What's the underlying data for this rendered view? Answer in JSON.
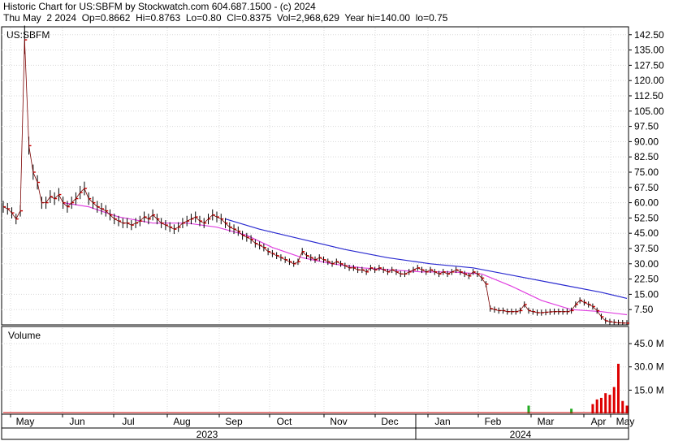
{
  "header": {
    "line1": "Historic Chart for US:SBFM by Stockwatch.com 604.687.1500 - (c) 2024",
    "line2": "Thu May  2 2024  Op=0.8662  Hi=0.8763  Lo=0.80  Cl=0.8375  Vol=2,968,629  Year hi=140.00  lo=0.75"
  },
  "chart_data": {
    "type": "bar",
    "symbol": "US:SBFM",
    "price_axis": {
      "range": [
        0,
        146
      ],
      "ticks": [
        142.5,
        135,
        127.5,
        120,
        112.5,
        105,
        97.5,
        90,
        82.5,
        75,
        67.5,
        60,
        52.5,
        45,
        37.5,
        30,
        22.5,
        15,
        7.5
      ],
      "tick_labels": [
        "142.50",
        "135.00",
        "127.50",
        "120.00",
        "112.50",
        "105.00",
        "97.50",
        "90.00",
        "82.50",
        "75.00",
        "67.50",
        "60.00",
        "52.50",
        "45.00",
        "37.50",
        "30.00",
        "22.50",
        "15.00",
        "7.50"
      ]
    },
    "volume_panel": {
      "label": "Volume",
      "range": [
        0,
        55
      ],
      "ticks": [
        45,
        30,
        15
      ],
      "tick_labels": [
        "45.0 M",
        "30.0 M",
        "15.0 M"
      ]
    },
    "x_axis": {
      "months": [
        "May",
        "Jun",
        "Jul",
        "Aug",
        "Sep",
        "Oct",
        "Nov",
        "Dec",
        "Jan",
        "Feb",
        "Mar",
        "Apr",
        "May"
      ],
      "years": [
        "2023",
        "2024"
      ]
    },
    "price_points": [
      [
        0,
        58
      ],
      [
        1,
        57
      ],
      [
        2,
        55
      ],
      [
        3,
        52
      ],
      [
        4,
        56
      ],
      [
        5,
        140
      ],
      [
        6,
        88
      ],
      [
        7,
        75
      ],
      [
        8,
        70
      ],
      [
        9,
        60
      ],
      [
        10,
        60
      ],
      [
        11,
        63
      ],
      [
        12,
        62
      ],
      [
        13,
        64
      ],
      [
        14,
        60
      ],
      [
        15,
        58
      ],
      [
        16,
        60
      ],
      [
        17,
        62
      ],
      [
        18,
        65
      ],
      [
        19,
        67
      ],
      [
        20,
        62
      ],
      [
        21,
        60
      ],
      [
        22,
        58
      ],
      [
        23,
        57
      ],
      [
        24,
        56
      ],
      [
        25,
        54
      ],
      [
        26,
        52
      ],
      [
        27,
        51
      ],
      [
        28,
        50
      ],
      [
        29,
        50
      ],
      [
        30,
        49
      ],
      [
        31,
        50
      ],
      [
        32,
        51
      ],
      [
        33,
        53
      ],
      [
        34,
        52
      ],
      [
        35,
        54
      ],
      [
        36,
        52
      ],
      [
        37,
        50
      ],
      [
        38,
        49
      ],
      [
        39,
        48
      ],
      [
        40,
        47
      ],
      [
        41,
        48
      ],
      [
        42,
        50
      ],
      [
        43,
        51
      ],
      [
        44,
        52
      ],
      [
        45,
        53
      ],
      [
        46,
        51
      ],
      [
        47,
        50
      ],
      [
        48,
        52
      ],
      [
        49,
        54
      ],
      [
        50,
        53
      ],
      [
        51,
        52
      ],
      [
        52,
        50
      ],
      [
        53,
        48
      ],
      [
        54,
        47
      ],
      [
        55,
        46
      ],
      [
        56,
        44
      ],
      [
        57,
        43
      ],
      [
        58,
        42
      ],
      [
        59,
        40
      ],
      [
        60,
        39
      ],
      [
        61,
        38
      ],
      [
        62,
        36
      ],
      [
        63,
        35
      ],
      [
        64,
        34
      ],
      [
        65,
        33
      ],
      [
        66,
        32
      ],
      [
        67,
        31
      ],
      [
        68,
        30
      ],
      [
        69,
        31
      ],
      [
        70,
        36
      ],
      [
        71,
        34
      ],
      [
        72,
        33
      ],
      [
        73,
        32
      ],
      [
        74,
        33
      ],
      [
        75,
        32
      ],
      [
        76,
        31
      ],
      [
        77,
        30
      ],
      [
        78,
        31
      ],
      [
        79,
        30
      ],
      [
        80,
        29
      ],
      [
        81,
        28
      ],
      [
        82,
        28
      ],
      [
        83,
        27
      ],
      [
        84,
        27
      ],
      [
        85,
        26
      ],
      [
        86,
        28
      ],
      [
        87,
        27
      ],
      [
        88,
        28
      ],
      [
        89,
        27
      ],
      [
        90,
        26
      ],
      [
        91,
        27
      ],
      [
        92,
        26
      ],
      [
        93,
        25
      ],
      [
        94,
        25
      ],
      [
        95,
        26
      ],
      [
        96,
        27
      ],
      [
        97,
        28
      ],
      [
        98,
        27
      ],
      [
        99,
        26
      ],
      [
        100,
        27
      ],
      [
        101,
        26
      ],
      [
        102,
        25
      ],
      [
        103,
        26
      ],
      [
        104,
        25
      ],
      [
        105,
        26
      ],
      [
        106,
        27
      ],
      [
        107,
        26
      ],
      [
        108,
        25
      ],
      [
        109,
        24
      ],
      [
        110,
        26
      ],
      [
        111,
        25
      ],
      [
        112,
        23
      ],
      [
        113,
        20
      ],
      [
        114,
        8
      ],
      [
        115,
        7.5
      ],
      [
        116,
        7
      ],
      [
        117,
        7
      ],
      [
        118,
        6.5
      ],
      [
        119,
        6.5
      ],
      [
        120,
        6.5
      ],
      [
        121,
        7
      ],
      [
        122,
        10
      ],
      [
        123,
        7
      ],
      [
        124,
        6.5
      ],
      [
        125,
        6
      ],
      [
        126,
        6
      ],
      [
        127,
        6.2
      ],
      [
        128,
        6.4
      ],
      [
        129,
        6.5
      ],
      [
        130,
        6.5
      ],
      [
        131,
        6.5
      ],
      [
        132,
        6.5
      ],
      [
        133,
        7
      ],
      [
        134,
        10
      ],
      [
        135,
        12
      ],
      [
        136,
        11
      ],
      [
        137,
        10
      ],
      [
        138,
        9
      ],
      [
        139,
        7
      ],
      [
        140,
        4
      ],
      [
        141,
        2
      ],
      [
        142,
        1.5
      ],
      [
        143,
        1.2
      ],
      [
        144,
        1
      ],
      [
        145,
        0.9
      ],
      [
        146,
        0.85
      ]
    ],
    "moving_average_50": [
      [
        14,
        60
      ],
      [
        20,
        58
      ],
      [
        27,
        53
      ],
      [
        35,
        50
      ],
      [
        43,
        50
      ],
      [
        50,
        48
      ],
      [
        57,
        44
      ],
      [
        63,
        38
      ],
      [
        70,
        33
      ],
      [
        77,
        30
      ],
      [
        84,
        28
      ],
      [
        91,
        27
      ],
      [
        98,
        26
      ],
      [
        105,
        26
      ],
      [
        112,
        25
      ],
      [
        119,
        19
      ],
      [
        126,
        12
      ],
      [
        133,
        7.5
      ],
      [
        140,
        6.5
      ],
      [
        146,
        5
      ]
    ],
    "moving_average_200": [
      [
        52,
        52
      ],
      [
        60,
        47
      ],
      [
        70,
        42
      ],
      [
        80,
        37
      ],
      [
        90,
        33
      ],
      [
        100,
        30
      ],
      [
        110,
        28
      ],
      [
        120,
        24
      ],
      [
        130,
        20
      ],
      [
        140,
        16
      ],
      [
        146,
        13
      ]
    ],
    "volume": [
      [
        123,
        5
      ],
      [
        133,
        3
      ],
      [
        138,
        6
      ],
      [
        139,
        9
      ],
      [
        140,
        10
      ],
      [
        141,
        13
      ],
      [
        142,
        12
      ],
      [
        143,
        17
      ],
      [
        144,
        32
      ],
      [
        145,
        8
      ],
      [
        146,
        5
      ]
    ],
    "grid": true
  }
}
